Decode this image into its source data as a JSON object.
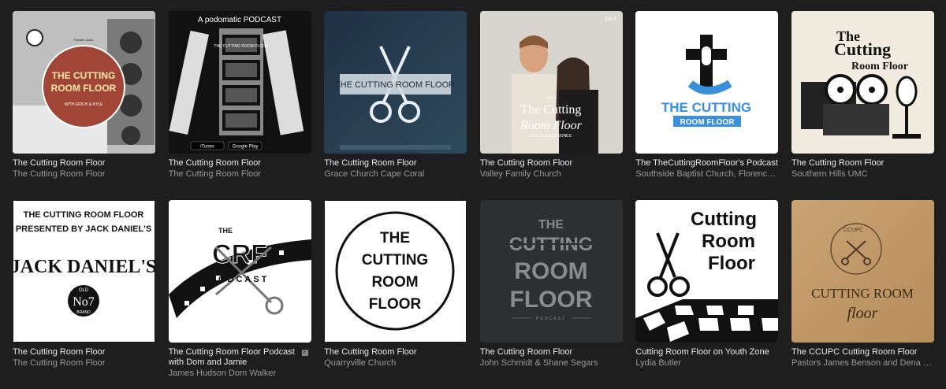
{
  "podcasts": [
    {
      "title": "The Cutting Room Floor",
      "author": "The Cutting Room Floor",
      "art": {
        "line1": "THE CUTTING",
        "line2": "ROOM FLOOR",
        "sub": "WITH ERICH & KYLE",
        "brand": "Theater Audio"
      }
    },
    {
      "title": "The Cutting Room Floor",
      "author": "The Cutting Room Floor",
      "art": {
        "top": "A podomatic PODCAST",
        "strip": "THE CUTTING ROOM FLOOR",
        "badge1": "iTunes",
        "badge2": "Google Play"
      }
    },
    {
      "title": "The Cutting Room Floor",
      "author": "Grace Church Cape Coral",
      "art": {
        "label": "THE CUTTING ROOM FLOOR"
      }
    },
    {
      "title": "The Cutting Room Floor",
      "author": "Valley Family Church",
      "art": {
        "corner": "E&A",
        "with": "WITH",
        "line1": "The Cutting",
        "line2": "Room Floor",
        "names": "ERIC & ALEXA JONES"
      }
    },
    {
      "title": "The TheCuttingRoomFloor's Podcast",
      "author": "Southside Baptist Church, Florence, SC",
      "art": {
        "line1": "THE CUTTING",
        "line2": "ROOM FLOOR"
      }
    },
    {
      "title": "The Cutting Room Floor",
      "author": "Southern Hills UMC",
      "art": {
        "line1": "The",
        "line2": "Cutting",
        "line3": "Room Floor"
      }
    },
    {
      "title": "The Cutting Room Floor",
      "author": "The Cutting Room Floor",
      "art": {
        "line1": "THE CUTTING ROOM FLOOR",
        "line2": "PRESENTED BY JACK DANIEL'S",
        "logo": "JACK DANIEL'S",
        "no": "No7",
        "old": "OLD",
        "brand": "BRAND"
      }
    },
    {
      "title": "The Cutting Room Floor Podcast with Dom and Jamie",
      "author": "James Hudson Dom Walker",
      "explicit": "E",
      "art": {
        "the": "THE",
        "crf": "CRF",
        "pod": "PODCAST"
      }
    },
    {
      "title": "The Cutting Room Floor",
      "author": "Quarryville Church",
      "art": {
        "l1": "THE",
        "l2": "CUTTING",
        "l3": "ROOM",
        "l4": "FLOOR"
      }
    },
    {
      "title": "The Cutting Room Floor",
      "author": "John Schmidt & Shane Segars",
      "art": {
        "l1": "THE",
        "l2": "CUTTING",
        "l3": "ROOM",
        "l4": "FLOOR",
        "l5": "PODCAST"
      }
    },
    {
      "title": "Cutting Room Floor on Youth Zone",
      "author": "Lydia Butler",
      "art": {
        "l1": "Cutting",
        "l2": "Room",
        "l3": "Floor"
      }
    },
    {
      "title": "The CCUPC Cutting Room Floor",
      "author": "Pastors James Benson and Dena Roy",
      "art": {
        "top": "CCUPC",
        "l1": "CUTTING ROOM",
        "l2": "floor"
      }
    }
  ],
  "colors": {
    "background": "#1e1e1e",
    "title": "#e9e9e9",
    "author": "#9a9a9a"
  }
}
